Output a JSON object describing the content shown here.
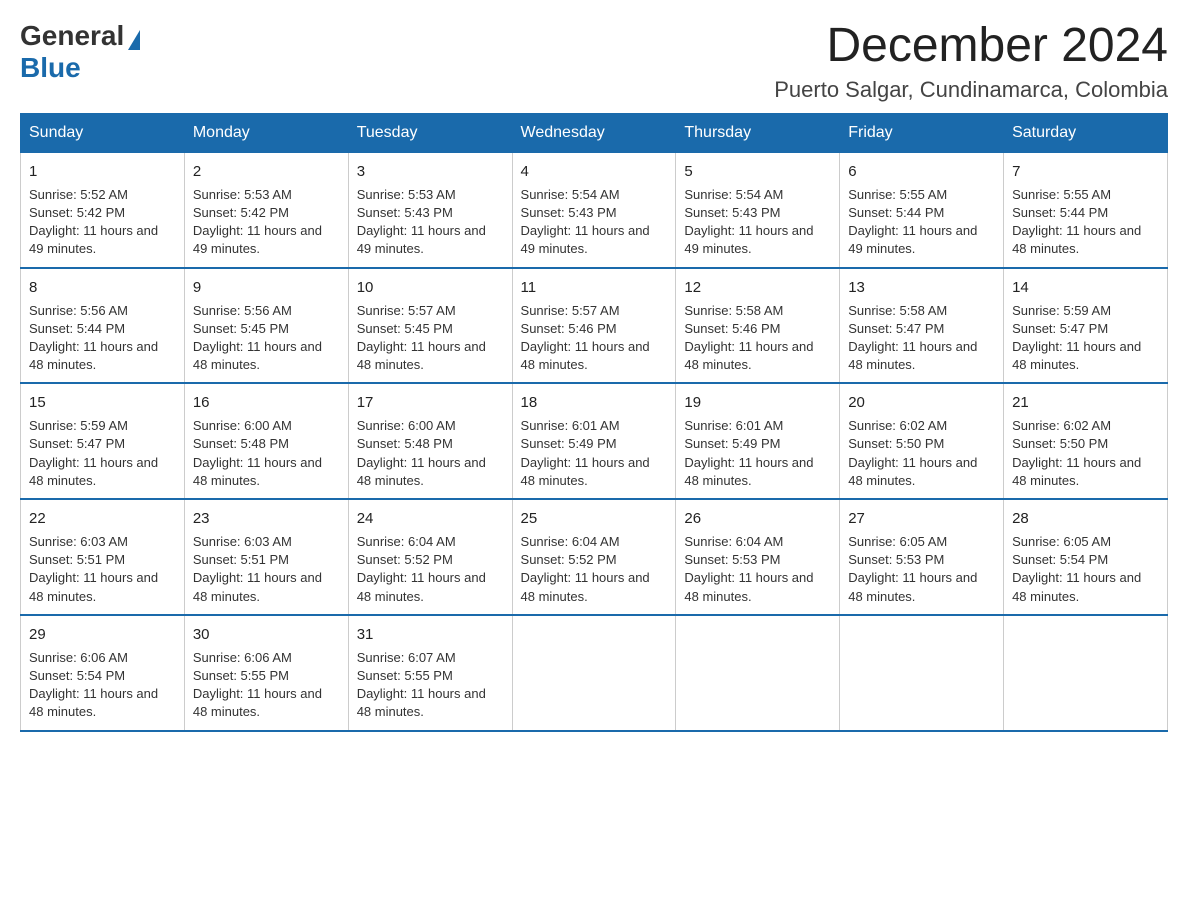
{
  "logo": {
    "general": "General",
    "blue": "Blue"
  },
  "title": "December 2024",
  "subtitle": "Puerto Salgar, Cundinamarca, Colombia",
  "days_of_week": [
    "Sunday",
    "Monday",
    "Tuesday",
    "Wednesday",
    "Thursday",
    "Friday",
    "Saturday"
  ],
  "weeks": [
    [
      {
        "day": "1",
        "sunrise": "5:52 AM",
        "sunset": "5:42 PM",
        "daylight": "11 hours and 49 minutes."
      },
      {
        "day": "2",
        "sunrise": "5:53 AM",
        "sunset": "5:42 PM",
        "daylight": "11 hours and 49 minutes."
      },
      {
        "day": "3",
        "sunrise": "5:53 AM",
        "sunset": "5:43 PM",
        "daylight": "11 hours and 49 minutes."
      },
      {
        "day": "4",
        "sunrise": "5:54 AM",
        "sunset": "5:43 PM",
        "daylight": "11 hours and 49 minutes."
      },
      {
        "day": "5",
        "sunrise": "5:54 AM",
        "sunset": "5:43 PM",
        "daylight": "11 hours and 49 minutes."
      },
      {
        "day": "6",
        "sunrise": "5:55 AM",
        "sunset": "5:44 PM",
        "daylight": "11 hours and 49 minutes."
      },
      {
        "day": "7",
        "sunrise": "5:55 AM",
        "sunset": "5:44 PM",
        "daylight": "11 hours and 48 minutes."
      }
    ],
    [
      {
        "day": "8",
        "sunrise": "5:56 AM",
        "sunset": "5:44 PM",
        "daylight": "11 hours and 48 minutes."
      },
      {
        "day": "9",
        "sunrise": "5:56 AM",
        "sunset": "5:45 PM",
        "daylight": "11 hours and 48 minutes."
      },
      {
        "day": "10",
        "sunrise": "5:57 AM",
        "sunset": "5:45 PM",
        "daylight": "11 hours and 48 minutes."
      },
      {
        "day": "11",
        "sunrise": "5:57 AM",
        "sunset": "5:46 PM",
        "daylight": "11 hours and 48 minutes."
      },
      {
        "day": "12",
        "sunrise": "5:58 AM",
        "sunset": "5:46 PM",
        "daylight": "11 hours and 48 minutes."
      },
      {
        "day": "13",
        "sunrise": "5:58 AM",
        "sunset": "5:47 PM",
        "daylight": "11 hours and 48 minutes."
      },
      {
        "day": "14",
        "sunrise": "5:59 AM",
        "sunset": "5:47 PM",
        "daylight": "11 hours and 48 minutes."
      }
    ],
    [
      {
        "day": "15",
        "sunrise": "5:59 AM",
        "sunset": "5:47 PM",
        "daylight": "11 hours and 48 minutes."
      },
      {
        "day": "16",
        "sunrise": "6:00 AM",
        "sunset": "5:48 PM",
        "daylight": "11 hours and 48 minutes."
      },
      {
        "day": "17",
        "sunrise": "6:00 AM",
        "sunset": "5:48 PM",
        "daylight": "11 hours and 48 minutes."
      },
      {
        "day": "18",
        "sunrise": "6:01 AM",
        "sunset": "5:49 PM",
        "daylight": "11 hours and 48 minutes."
      },
      {
        "day": "19",
        "sunrise": "6:01 AM",
        "sunset": "5:49 PM",
        "daylight": "11 hours and 48 minutes."
      },
      {
        "day": "20",
        "sunrise": "6:02 AM",
        "sunset": "5:50 PM",
        "daylight": "11 hours and 48 minutes."
      },
      {
        "day": "21",
        "sunrise": "6:02 AM",
        "sunset": "5:50 PM",
        "daylight": "11 hours and 48 minutes."
      }
    ],
    [
      {
        "day": "22",
        "sunrise": "6:03 AM",
        "sunset": "5:51 PM",
        "daylight": "11 hours and 48 minutes."
      },
      {
        "day": "23",
        "sunrise": "6:03 AM",
        "sunset": "5:51 PM",
        "daylight": "11 hours and 48 minutes."
      },
      {
        "day": "24",
        "sunrise": "6:04 AM",
        "sunset": "5:52 PM",
        "daylight": "11 hours and 48 minutes."
      },
      {
        "day": "25",
        "sunrise": "6:04 AM",
        "sunset": "5:52 PM",
        "daylight": "11 hours and 48 minutes."
      },
      {
        "day": "26",
        "sunrise": "6:04 AM",
        "sunset": "5:53 PM",
        "daylight": "11 hours and 48 minutes."
      },
      {
        "day": "27",
        "sunrise": "6:05 AM",
        "sunset": "5:53 PM",
        "daylight": "11 hours and 48 minutes."
      },
      {
        "day": "28",
        "sunrise": "6:05 AM",
        "sunset": "5:54 PM",
        "daylight": "11 hours and 48 minutes."
      }
    ],
    [
      {
        "day": "29",
        "sunrise": "6:06 AM",
        "sunset": "5:54 PM",
        "daylight": "11 hours and 48 minutes."
      },
      {
        "day": "30",
        "sunrise": "6:06 AM",
        "sunset": "5:55 PM",
        "daylight": "11 hours and 48 minutes."
      },
      {
        "day": "31",
        "sunrise": "6:07 AM",
        "sunset": "5:55 PM",
        "daylight": "11 hours and 48 minutes."
      },
      null,
      null,
      null,
      null
    ]
  ]
}
